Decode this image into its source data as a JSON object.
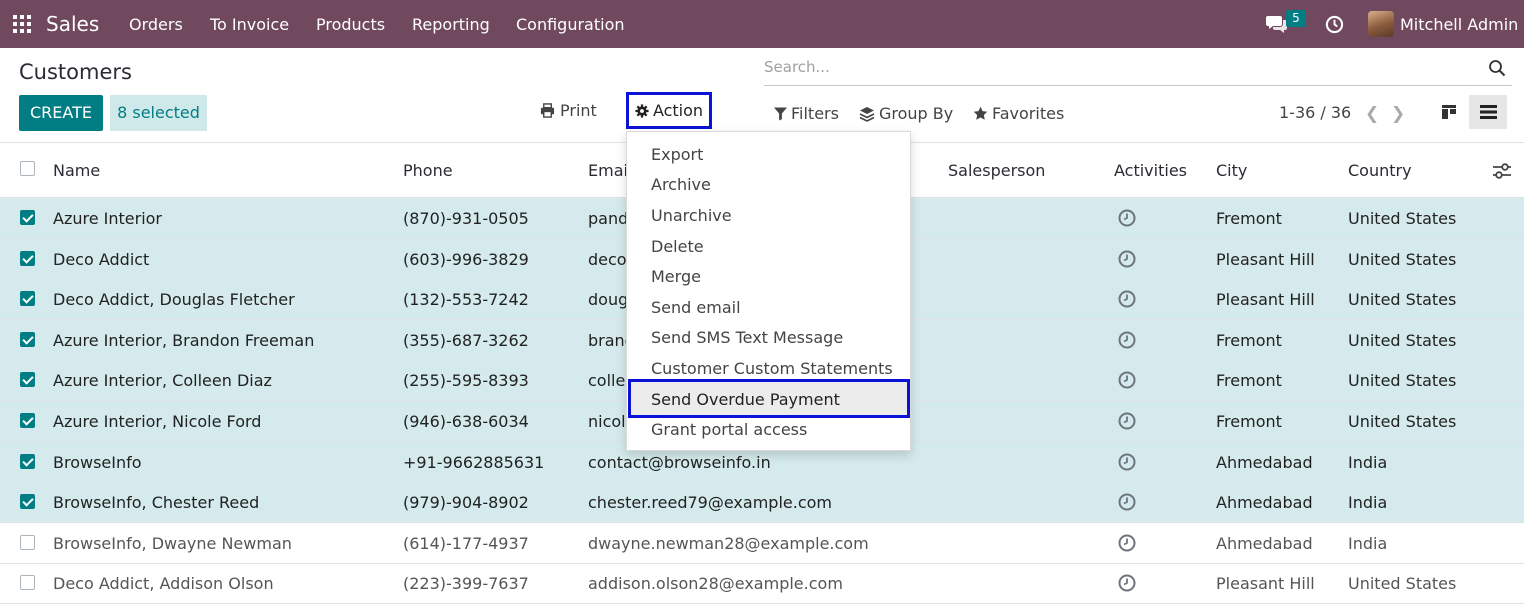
{
  "navbar": {
    "brand": "Sales",
    "menu": [
      "Orders",
      "To Invoice",
      "Products",
      "Reporting",
      "Configuration"
    ],
    "chat_count": "5",
    "user_name": "Mitchell Admin",
    "bg_color": "#71495f"
  },
  "control": {
    "title": "Customers",
    "create_label": "CREATE",
    "selected_label": "8 selected",
    "print_label": "Print",
    "action_label": "Action",
    "search_placeholder": "Search...",
    "filters_label": "Filters",
    "groupby_label": "Group By",
    "favorites_label": "Favorites",
    "pager": "1-36 / 36"
  },
  "table": {
    "columns": [
      "Name",
      "Phone",
      "Email",
      "Salesperson",
      "Activities",
      "City",
      "Country"
    ],
    "rows": [
      {
        "name": "Azure Interior",
        "phone": "(870)-931-0505",
        "email": "pand",
        "city": "Fremont",
        "country": "United States",
        "selected": true
      },
      {
        "name": "Deco Addict",
        "phone": "(603)-996-3829",
        "email": "deco",
        "city": "Pleasant Hill",
        "country": "United States",
        "selected": true
      },
      {
        "name": "Deco Addict, Douglas Fletcher",
        "phone": "(132)-553-7242",
        "email": "doug",
        "city": "Pleasant Hill",
        "country": "United States",
        "selected": true
      },
      {
        "name": "Azure Interior, Brandon Freeman",
        "phone": "(355)-687-3262",
        "email": "brand",
        "city": "Fremont",
        "country": "United States",
        "selected": true
      },
      {
        "name": "Azure Interior, Colleen Diaz",
        "phone": "(255)-595-8393",
        "email": "colle",
        "city": "Fremont",
        "country": "United States",
        "selected": true
      },
      {
        "name": "Azure Interior, Nicole Ford",
        "phone": "(946)-638-6034",
        "email": "nicol",
        "city": "Fremont",
        "country": "United States",
        "selected": true
      },
      {
        "name": "BrowseInfo",
        "phone": "+91-9662885631",
        "email": "contact@browseinfo.in",
        "city": "Ahmedabad",
        "country": "India",
        "selected": true
      },
      {
        "name": "BrowseInfo, Chester Reed",
        "phone": "(979)-904-8902",
        "email": "chester.reed79@example.com",
        "city": "Ahmedabad",
        "country": "India",
        "selected": true
      },
      {
        "name": "BrowseInfo, Dwayne Newman",
        "phone": "(614)-177-4937",
        "email": "dwayne.newman28@example.com",
        "city": "Ahmedabad",
        "country": "India",
        "selected": false
      },
      {
        "name": "Deco Addict, Addison Olson",
        "phone": "(223)-399-7637",
        "email": "addison.olson28@example.com",
        "city": "Pleasant Hill",
        "country": "United States",
        "selected": false
      }
    ]
  },
  "action_menu": {
    "items": [
      "Export",
      "Archive",
      "Unarchive",
      "Delete",
      "Merge",
      "Send email",
      "Send SMS Text Message",
      "Customer Custom Statements",
      "Send Overdue Payment",
      "Grant portal access"
    ],
    "highlighted": "Send Overdue Payment"
  }
}
